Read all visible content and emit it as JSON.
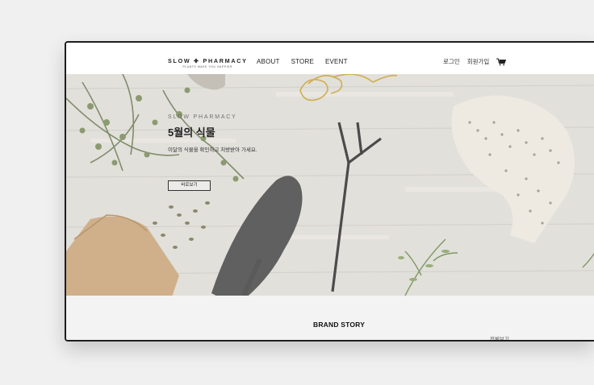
{
  "header": {
    "logo_main": "SLOW ✚ PHARMACY",
    "logo_tagline": "PLANTS MAKE YOU HAPPIER",
    "nav": [
      "ABOUT",
      "STORE",
      "EVENT"
    ],
    "login_label": "로그인",
    "signup_label": "회원가입",
    "cart_icon": "cart-icon"
  },
  "hero": {
    "eyebrow": "SLOW PHARMACY",
    "title": "5월의 식물",
    "description": "이달의 식물을 확인하고 처방받아 가세요.",
    "button_label": "바로보기"
  },
  "brand_story": {
    "title": "BRAND STORY",
    "see_all_label": "전체보기"
  },
  "colors": {
    "frame": "#1e1e1e",
    "background": "#f0f0f0",
    "section_bg": "#f3f3f3"
  }
}
